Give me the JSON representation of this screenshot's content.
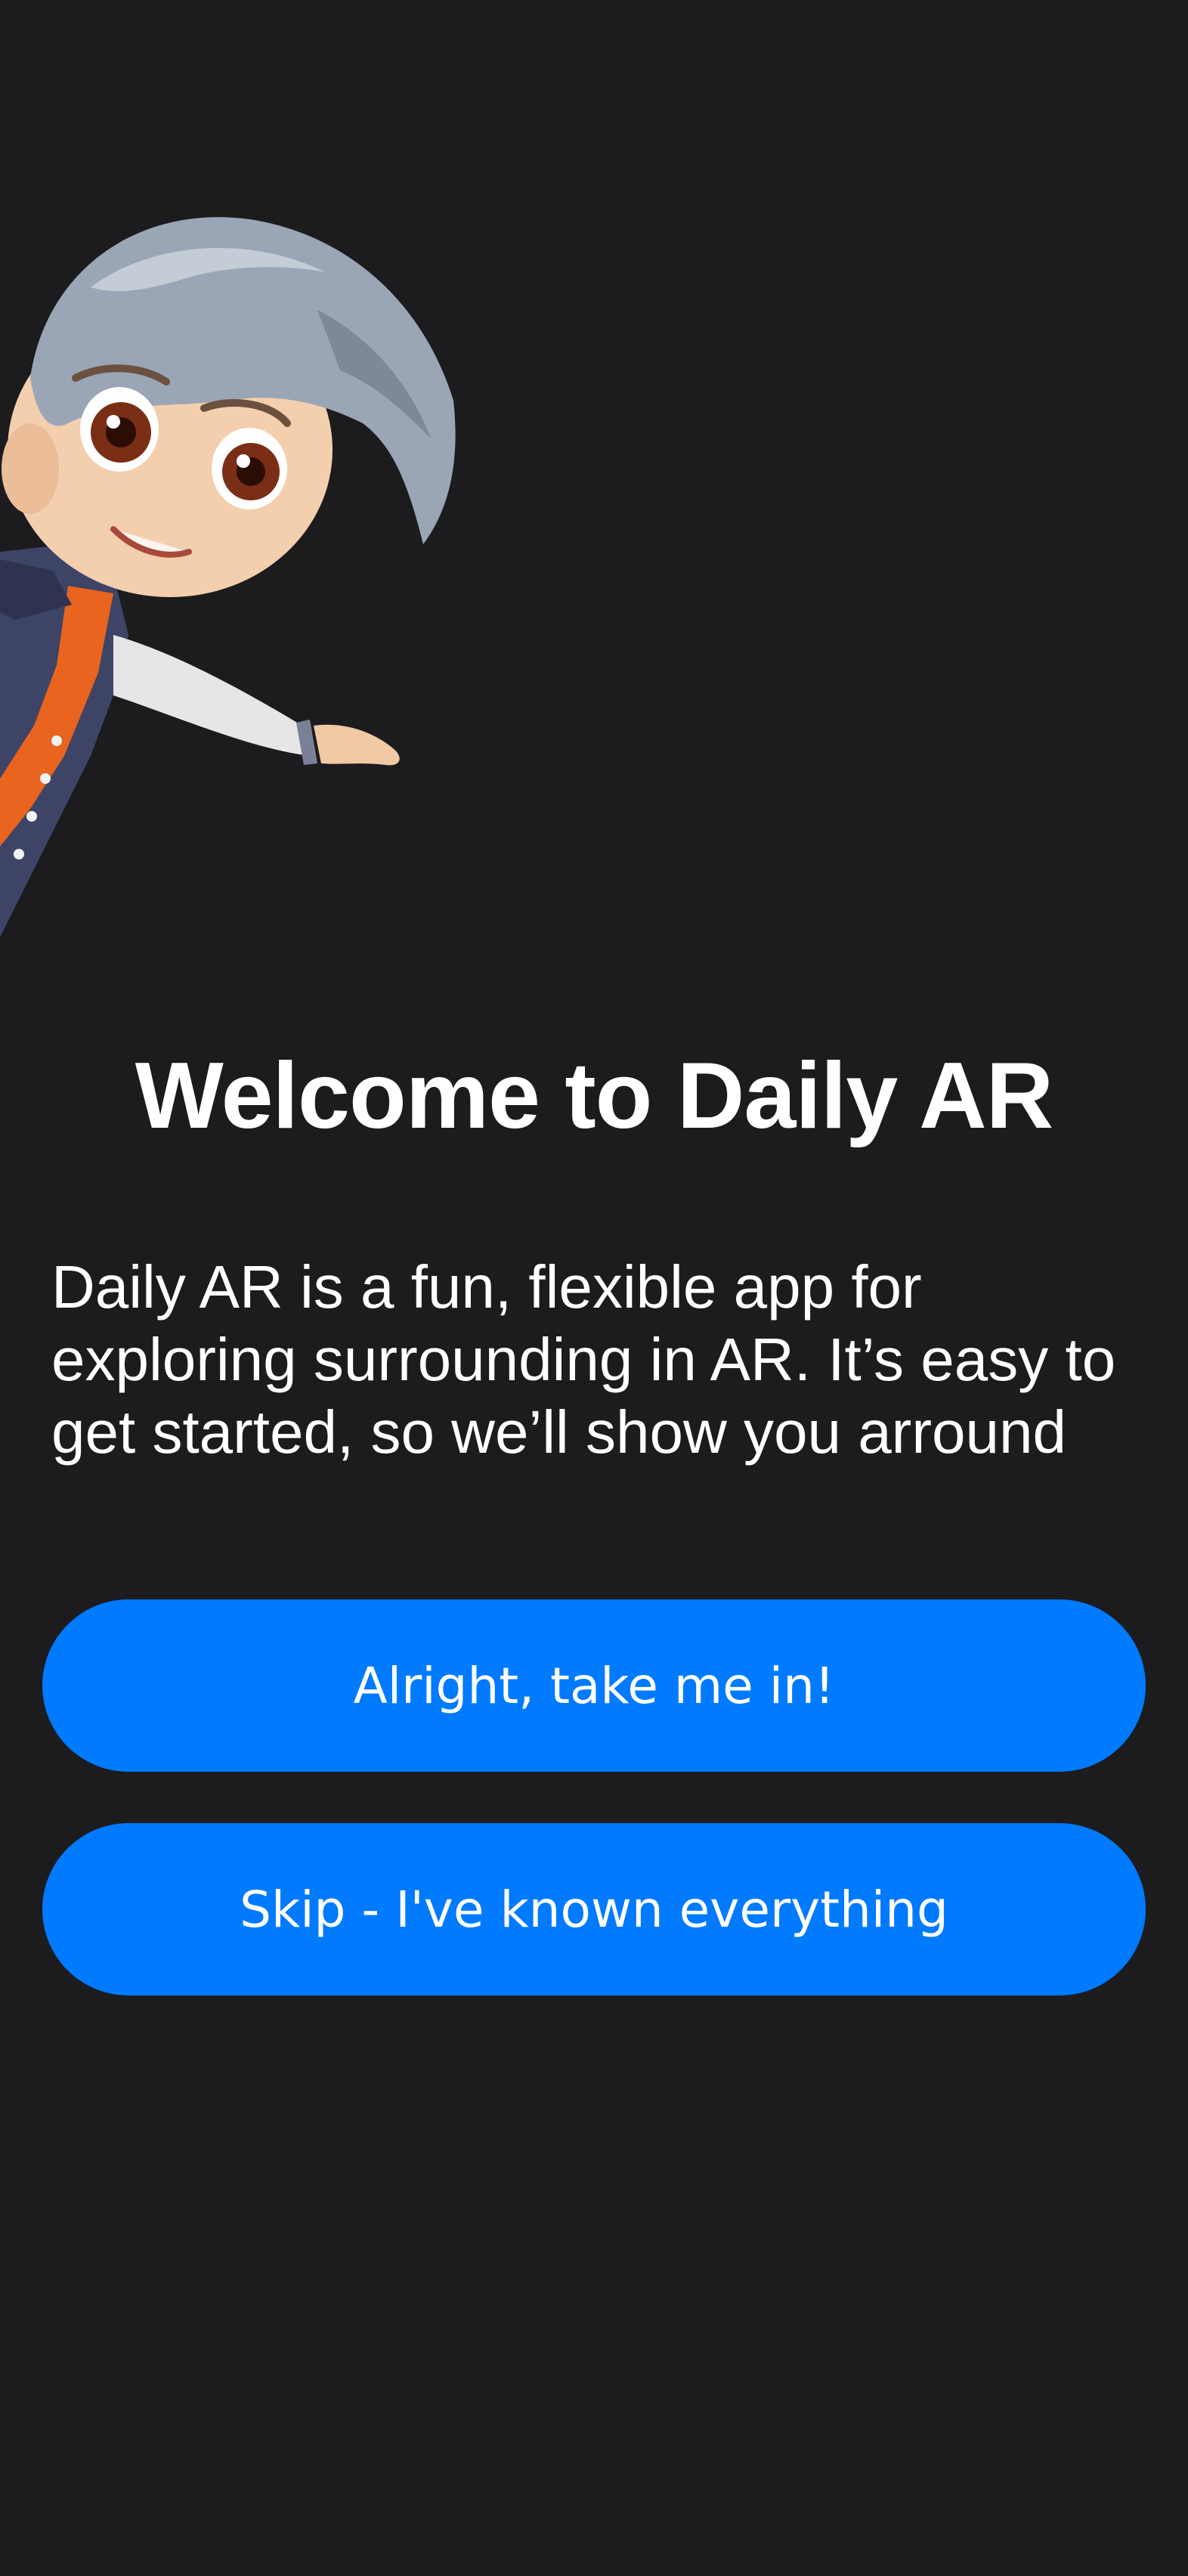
{
  "onboarding": {
    "mascot": "cartoon-boy-mascot",
    "title": "Welcome to Daily AR",
    "description": "Daily AR is a fun, flexible app for exploring surrounding in AR. It’s easy to get started, so we’ll show you arround",
    "primary_button_label": "Alright, take me in!",
    "secondary_button_label": "Skip - I've known everything"
  },
  "colors": {
    "background": "#1c1c1e",
    "accent": "#007aff",
    "text": "#ffffff"
  }
}
